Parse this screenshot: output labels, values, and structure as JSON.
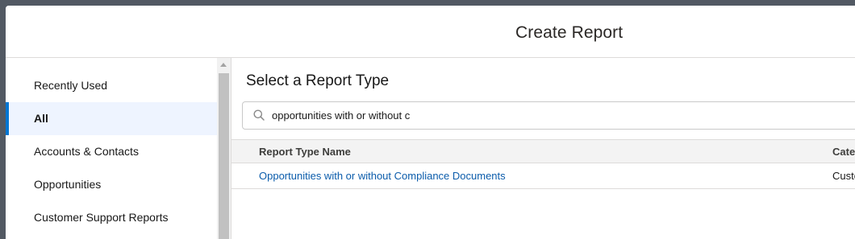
{
  "modal": {
    "title": "Create Report"
  },
  "sidebar": {
    "items": [
      {
        "label": "Recently Used",
        "active": false
      },
      {
        "label": "All",
        "active": true
      },
      {
        "label": "Accounts & Contacts",
        "active": false
      },
      {
        "label": "Opportunities",
        "active": false
      },
      {
        "label": "Customer Support Reports",
        "active": false
      }
    ]
  },
  "main": {
    "section_title": "Select a Report Type",
    "search": {
      "value": "opportunities with or without c",
      "icon": "search-icon"
    },
    "table": {
      "columns": [
        "Report Type Name",
        "Categ"
      ],
      "rows": [
        {
          "name": "Opportunities with or without Compliance Documents",
          "category": "Custo"
        }
      ]
    }
  },
  "colors": {
    "accent": "#0176d3",
    "active_bg": "#eef4ff",
    "link": "#0b5cab",
    "overlay": "#525963"
  }
}
